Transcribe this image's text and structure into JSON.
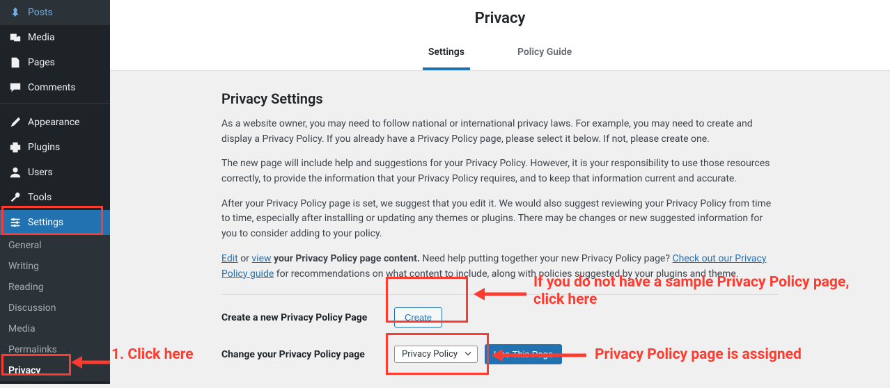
{
  "sidebar": {
    "items": [
      {
        "label": "Posts",
        "icon": "pin"
      },
      {
        "label": "Media",
        "icon": "media"
      },
      {
        "label": "Pages",
        "icon": "page"
      },
      {
        "label": "Comments",
        "icon": "comment"
      },
      {
        "label": "Appearance",
        "icon": "brush"
      },
      {
        "label": "Plugins",
        "icon": "plugin"
      },
      {
        "label": "Users",
        "icon": "user"
      },
      {
        "label": "Tools",
        "icon": "wrench"
      },
      {
        "label": "Settings",
        "icon": "sliders"
      }
    ],
    "submenu": [
      "General",
      "Writing",
      "Reading",
      "Discussion",
      "Media",
      "Permalinks",
      "Privacy"
    ]
  },
  "header": {
    "title": "Privacy",
    "tabs": [
      "Settings",
      "Policy Guide"
    ]
  },
  "content": {
    "section_title": "Privacy Settings",
    "p1": "As a website owner, you may need to follow national or international privacy laws. For example, you may need to create and display a Privacy Policy. If you already have a Privacy Policy page, please select it below. If not, please create one.",
    "p2": "The new page will include help and suggestions for your Privacy Policy. However, it is your responsibility to use those resources correctly, to provide the information that your Privacy Policy requires, and to keep that information current and accurate.",
    "p3": "After your Privacy Policy page is set, we suggest that you edit it. We would also suggest reviewing your Privacy Policy from time to time, especially after installing or updating any themes or plugins. There may be changes or new suggested information for you to consider adding to your policy.",
    "edit_text": "Edit",
    "or_text": " or ",
    "view_text": "view",
    "p4_after": " your Privacy Policy page content.",
    "p4_need": " Need help putting together your new Privacy Policy page? ",
    "guide_link": "Check out our Privacy Policy guide",
    "p4_end": " for recommendations on what content to include, along with policies suggested by your plugins and theme.",
    "create_label": "Create a new Privacy Policy Page",
    "create_button": "Create",
    "change_label": "Change your Privacy Policy page",
    "select_value": "Privacy Policy",
    "use_button": "Use This Page"
  },
  "annotations": {
    "click_here": "1. Click here",
    "no_sample": "If you do not have a sample Privacy Policy page, click here",
    "assigned": "Privacy Policy page is assigned"
  }
}
